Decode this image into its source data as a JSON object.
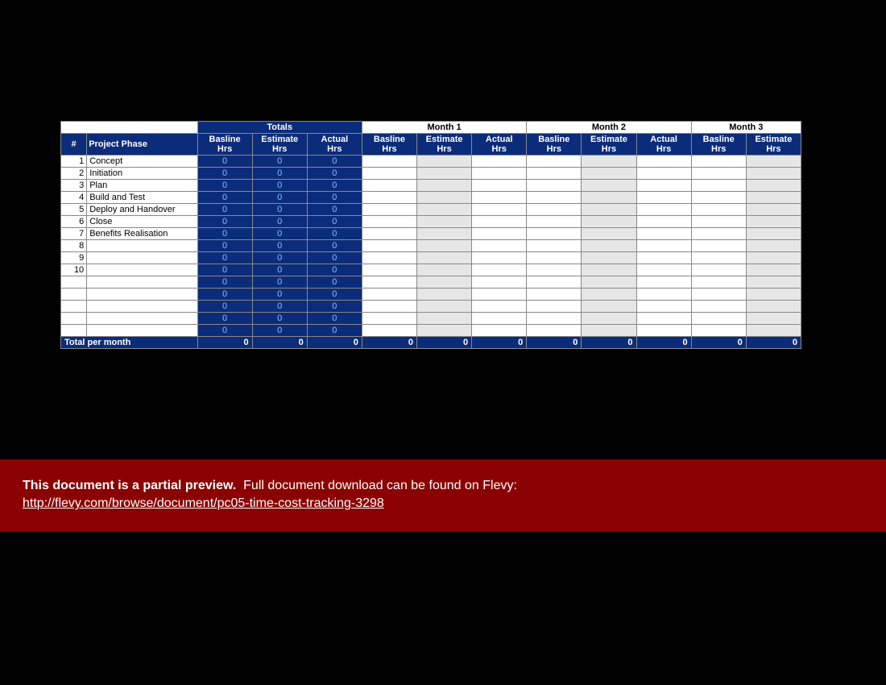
{
  "groups": {
    "totals_label": "Totals",
    "months": [
      "Month 1",
      "Month 2",
      "Month 3"
    ]
  },
  "headers": {
    "num": "#",
    "phase": "Project Phase",
    "baseline": "Basline Hrs",
    "estimate": "Estimate Hrs",
    "actual": "Actual Hrs"
  },
  "rows": [
    {
      "n": "1",
      "phase": "Concept",
      "t": [
        "0",
        "0",
        "0"
      ]
    },
    {
      "n": "2",
      "phase": "Initiation",
      "t": [
        "0",
        "0",
        "0"
      ]
    },
    {
      "n": "3",
      "phase": "Plan",
      "t": [
        "0",
        "0",
        "0"
      ]
    },
    {
      "n": "4",
      "phase": "Build and Test",
      "t": [
        "0",
        "0",
        "0"
      ]
    },
    {
      "n": "5",
      "phase": "Deploy and Handover",
      "t": [
        "0",
        "0",
        "0"
      ]
    },
    {
      "n": "6",
      "phase": "Close",
      "t": [
        "0",
        "0",
        "0"
      ]
    },
    {
      "n": "7",
      "phase": "Benefits Realisation",
      "t": [
        "0",
        "0",
        "0"
      ]
    },
    {
      "n": "8",
      "phase": "",
      "t": [
        "0",
        "0",
        "0"
      ]
    },
    {
      "n": "9",
      "phase": "",
      "t": [
        "0",
        "0",
        "0"
      ]
    },
    {
      "n": "10",
      "phase": "",
      "t": [
        "0",
        "0",
        "0"
      ]
    },
    {
      "n": "",
      "phase": "",
      "t": [
        "0",
        "0",
        "0"
      ]
    },
    {
      "n": "",
      "phase": "",
      "t": [
        "0",
        "0",
        "0"
      ]
    },
    {
      "n": "",
      "phase": "",
      "t": [
        "0",
        "0",
        "0"
      ]
    },
    {
      "n": "",
      "phase": "",
      "t": [
        "0",
        "0",
        "0"
      ]
    },
    {
      "n": "",
      "phase": "",
      "t": [
        "0",
        "0",
        "0"
      ]
    }
  ],
  "monthly_totals": {
    "label": "Total per month",
    "totals": [
      "0",
      "0",
      "0"
    ],
    "months": [
      [
        "0",
        "0",
        "0"
      ],
      [
        "0",
        "0",
        "0"
      ],
      [
        "0",
        "0"
      ]
    ]
  },
  "banner": {
    "bold": "This document is a partial preview.",
    "rest": "Full document download can be found on Flevy:",
    "link": "http://flevy.com/browse/document/pc05-time-cost-tracking-3298"
  }
}
